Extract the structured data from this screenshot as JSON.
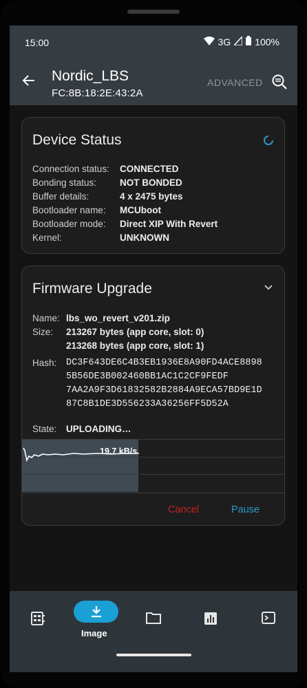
{
  "status_bar": {
    "time": "15:00",
    "network": "3G",
    "battery": "100%"
  },
  "app_bar": {
    "title": "Nordic_LBS",
    "subtitle": "FC:8B:18:2E:43:2A",
    "advanced_label": "ADVANCED"
  },
  "device_status": {
    "title": "Device Status",
    "rows": [
      {
        "label": "Connection status:",
        "value": "CONNECTED"
      },
      {
        "label": "Bonding status:",
        "value": "NOT BONDED"
      },
      {
        "label": "Buffer details:",
        "value": "4 x 2475 bytes"
      },
      {
        "label": "Bootloader name:",
        "value": "MCUboot"
      },
      {
        "label": "Bootloader mode:",
        "value": "Direct XIP With Revert"
      },
      {
        "label": "Kernel:",
        "value": "UNKNOWN"
      }
    ]
  },
  "firmware_upgrade": {
    "title": "Firmware Upgrade",
    "name_label": "Name:",
    "name_value": "lbs_wo_revert_v201.zip",
    "size_label": "Size:",
    "size_line1": "213267 bytes (app core, slot: 0)",
    "size_line2": "213268 bytes (app core, slot: 1)",
    "hash_label": "Hash:",
    "hash_lines": [
      "DC3F643DE6C4B3EB1936E8A90FD4ACE8898",
      "5B56DE3B002460BB1AC1C2CF9FEDF",
      "7AA2A9F3D61832582B2884A9ECA57BD9E1D",
      "87C8B1DE3D556233A36256FF5D52A"
    ],
    "state_label": "State:",
    "state_value": "UPLOADING…",
    "speed": "19.7 kB/s",
    "progress": 0.44,
    "cancel_label": "Cancel",
    "pause_label": "Pause"
  },
  "bottom_nav": {
    "active_label": "Image",
    "items": [
      "device-info",
      "image",
      "files",
      "stats",
      "shell"
    ]
  },
  "colors": {
    "accent": "#1aa0d4",
    "cancel": "#c2221f",
    "pause": "#2c9ac4",
    "appbar": "#353c42"
  }
}
